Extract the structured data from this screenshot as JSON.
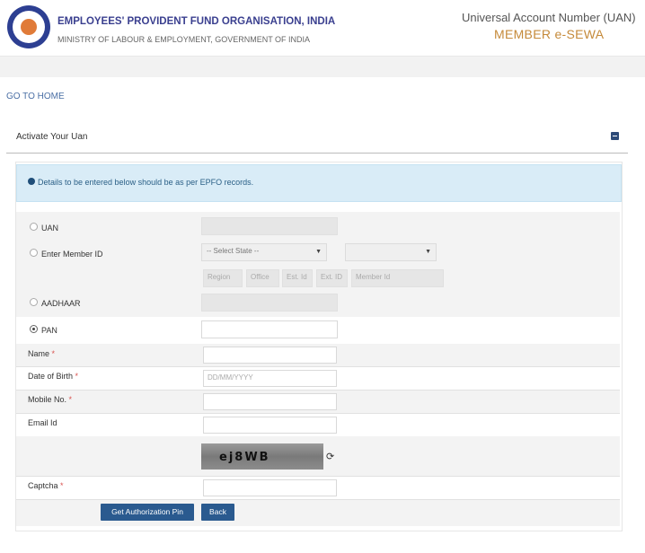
{
  "header": {
    "org_name": "EMPLOYEES' PROVIDENT FUND ORGANISATION, INDIA",
    "ministry": "MINISTRY OF LABOUR & EMPLOYMENT, GOVERNMENT OF INDIA",
    "uan_title": "Universal Account Number (UAN)",
    "portal_name": "MEMBER e-SEWA"
  },
  "nav": {
    "go_home": "GO TO HOME"
  },
  "panel": {
    "title": "Activate Your Uan"
  },
  "alert": {
    "text": "Details to be entered below should be as per EPFO records."
  },
  "form": {
    "uan_label": "UAN",
    "member_id_label": "Enter Member ID",
    "state_select": "-- Select State --",
    "office_select": "",
    "member_parts": {
      "region": "Region",
      "office": "Office",
      "est_id": "Est. Id",
      "ext_id": "Ext. ID",
      "member_id": "Member Id"
    },
    "aadhaar_label": "AADHAAR",
    "pan_label": "PAN",
    "selected_option": "PAN",
    "name_label": "Name",
    "dob_label": "Date of Birth",
    "dob_placeholder": "DD/MM/YYYY",
    "mobile_label": "Mobile No.",
    "email_label": "Email Id",
    "captcha_label": "Captcha",
    "captcha_image_text": "ej8WB",
    "required_mark": "*"
  },
  "buttons": {
    "get_pin": "Get Authorization Pin",
    "back": "Back"
  },
  "colors": {
    "brand_blue": "#2d3f92",
    "accent_gold": "#c58a3a",
    "button_blue": "#2a5a8f",
    "alert_bg": "#d9ecf7"
  }
}
